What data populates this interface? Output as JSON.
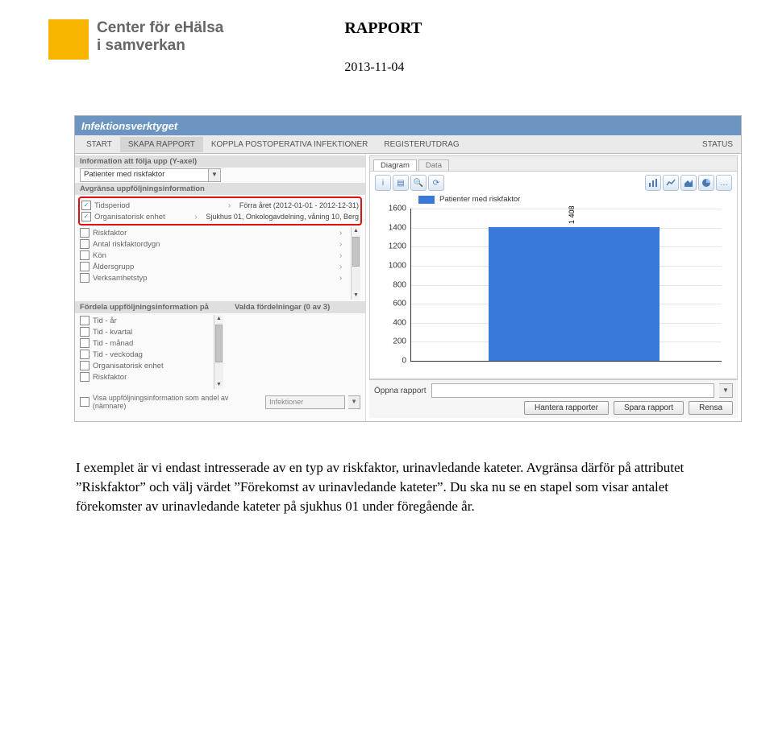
{
  "header": {
    "logo_lines": [
      "Center för eHälsa",
      "i samverkan"
    ],
    "title": "RAPPORT",
    "date": "2013-11-04"
  },
  "app": {
    "title": "Infektionsverktyget",
    "tabs": [
      "START",
      "SKAPA RAPPORT",
      "KOPPLA POSTOPERATIVA INFEKTIONER",
      "REGISTERUTDRAG"
    ],
    "active_tab": 1,
    "status_label": "STATUS"
  },
  "yaxis": {
    "header": "Information att följa upp (Y-axel)",
    "value": "Patienter med riskfaktor"
  },
  "limit": {
    "header": "Avgränsa uppföljningsinformation",
    "rows": [
      {
        "checked": true,
        "label": "Tidsperiod",
        "value": "Förra året (2012-01-01 - 2012-12-31)"
      },
      {
        "checked": true,
        "label": "Organisatorisk enhet",
        "value": "Sjukhus 01, Onkologavdelning, våning 10, Berg"
      },
      {
        "checked": false,
        "label": "Riskfaktor",
        "value": ""
      },
      {
        "checked": false,
        "label": "Antal riskfaktordygn",
        "value": ""
      },
      {
        "checked": false,
        "label": "Kön",
        "value": ""
      },
      {
        "checked": false,
        "label": "Åldersgrupp",
        "value": ""
      },
      {
        "checked": false,
        "label": "Verksamhetstyp",
        "value": ""
      }
    ]
  },
  "distribute": {
    "header": "Fördela uppföljningsinformation på",
    "selected_header": "Valda fördelningar (0 av 3)",
    "rows": [
      "Tid - år",
      "Tid - kvartal",
      "Tid - månad",
      "Tid - veckodag",
      "Organisatorisk enhet",
      "Riskfaktor"
    ]
  },
  "share": {
    "label": "Visa uppföljningsinformation som andel av (nämnare)",
    "value": "Infektioner"
  },
  "chart_tabs": {
    "active": "Diagram",
    "inactive": "Data"
  },
  "chart_toolbar": {
    "left": [
      "info",
      "reports",
      "zoom",
      "marker"
    ],
    "right": [
      "bar",
      "line",
      "area",
      "pie",
      "other"
    ]
  },
  "chart_data": {
    "type": "bar",
    "title": "",
    "xlabel": "",
    "ylabel": "",
    "ylim": [
      0,
      1600
    ],
    "yticks": [
      0,
      200,
      400,
      600,
      800,
      1000,
      1200,
      1400,
      1600
    ],
    "series": [
      {
        "name": "Patienter med riskfaktor",
        "values": [
          1408
        ]
      }
    ],
    "categories": [
      ""
    ],
    "value_label": "1 408"
  },
  "footer": {
    "open_label": "Öppna rapport",
    "buttons": [
      "Hantera rapporter",
      "Spara rapport",
      "Rensa"
    ]
  },
  "body_text": "I exemplet är vi endast intresserade av en typ av riskfaktor, urinavledande kateter. Avgränsa därför på attributet ”Riskfaktor” och välj värdet ”Förekomst av urinavledande kateter”. Du ska nu se en stapel som visar antalet förekomster av urinavledande kateter på sjukhus 01 under föregående år."
}
